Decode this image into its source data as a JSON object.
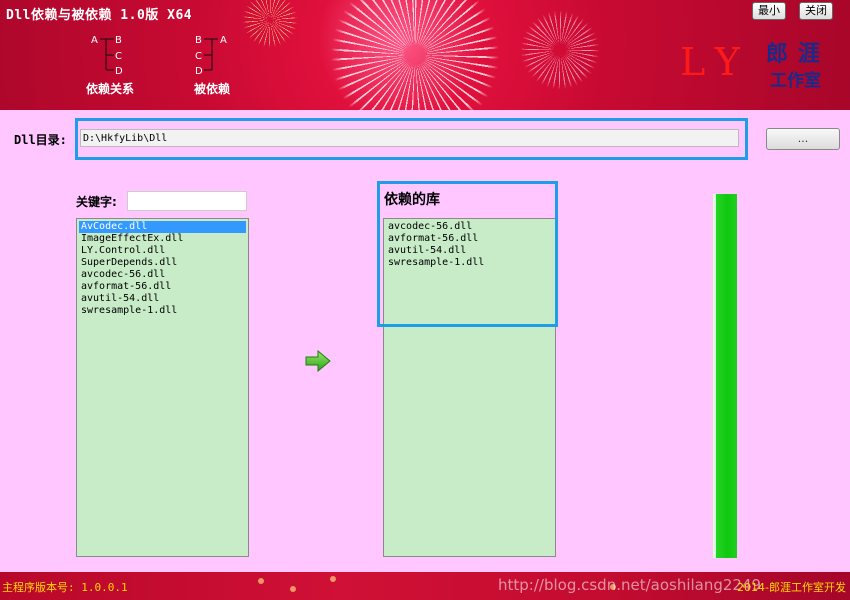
{
  "window": {
    "title": "Dll依赖与被依赖 1.0版 X64",
    "minimize_label": "最小",
    "close_label": "关闭"
  },
  "modes": {
    "depends": {
      "label": "依赖关系",
      "diagram": {
        "left": "A",
        "right": [
          "B",
          "C",
          "D"
        ]
      }
    },
    "depended_by": {
      "label": "被依赖",
      "diagram": {
        "left": [
          "B",
          "C",
          "D"
        ],
        "right": "A"
      }
    }
  },
  "logo": {
    "ly": "LY",
    "lang": "郎涯",
    "studio": "工作室"
  },
  "directory": {
    "label": "Dll目录:",
    "value": "D:\\HkfyLib\\Dll",
    "browse_label": "..."
  },
  "keyword": {
    "label": "关键字:",
    "value": ""
  },
  "dll_list": {
    "items": [
      "AvCodec.dll",
      "ImageEffectEx.dll",
      "LY.Control.dll",
      "SuperDepends.dll",
      "avcodec-56.dll",
      "avformat-56.dll",
      "avutil-54.dll",
      "swresample-1.dll"
    ],
    "selected_index": 0
  },
  "dependencies": {
    "title": "依赖的库",
    "items": [
      "avcodec-56.dll",
      "avformat-56.dll",
      "avutil-54.dll",
      "swresample-1.dll"
    ]
  },
  "progress": {
    "fill_fraction": 1.0,
    "color": "#10c810"
  },
  "footer": {
    "version": "主程序版本号: 1.0.0.1",
    "watermark": "http://blog.csdn.net/aoshilang2249",
    "credit": "2014-郎涯工作室开发"
  },
  "colors": {
    "background": "#ffc6ff",
    "banner": "#c80a32",
    "list_bg": "#c8ecc8",
    "highlight_frame": "#1e9ee6",
    "selection": "#3399ff"
  }
}
